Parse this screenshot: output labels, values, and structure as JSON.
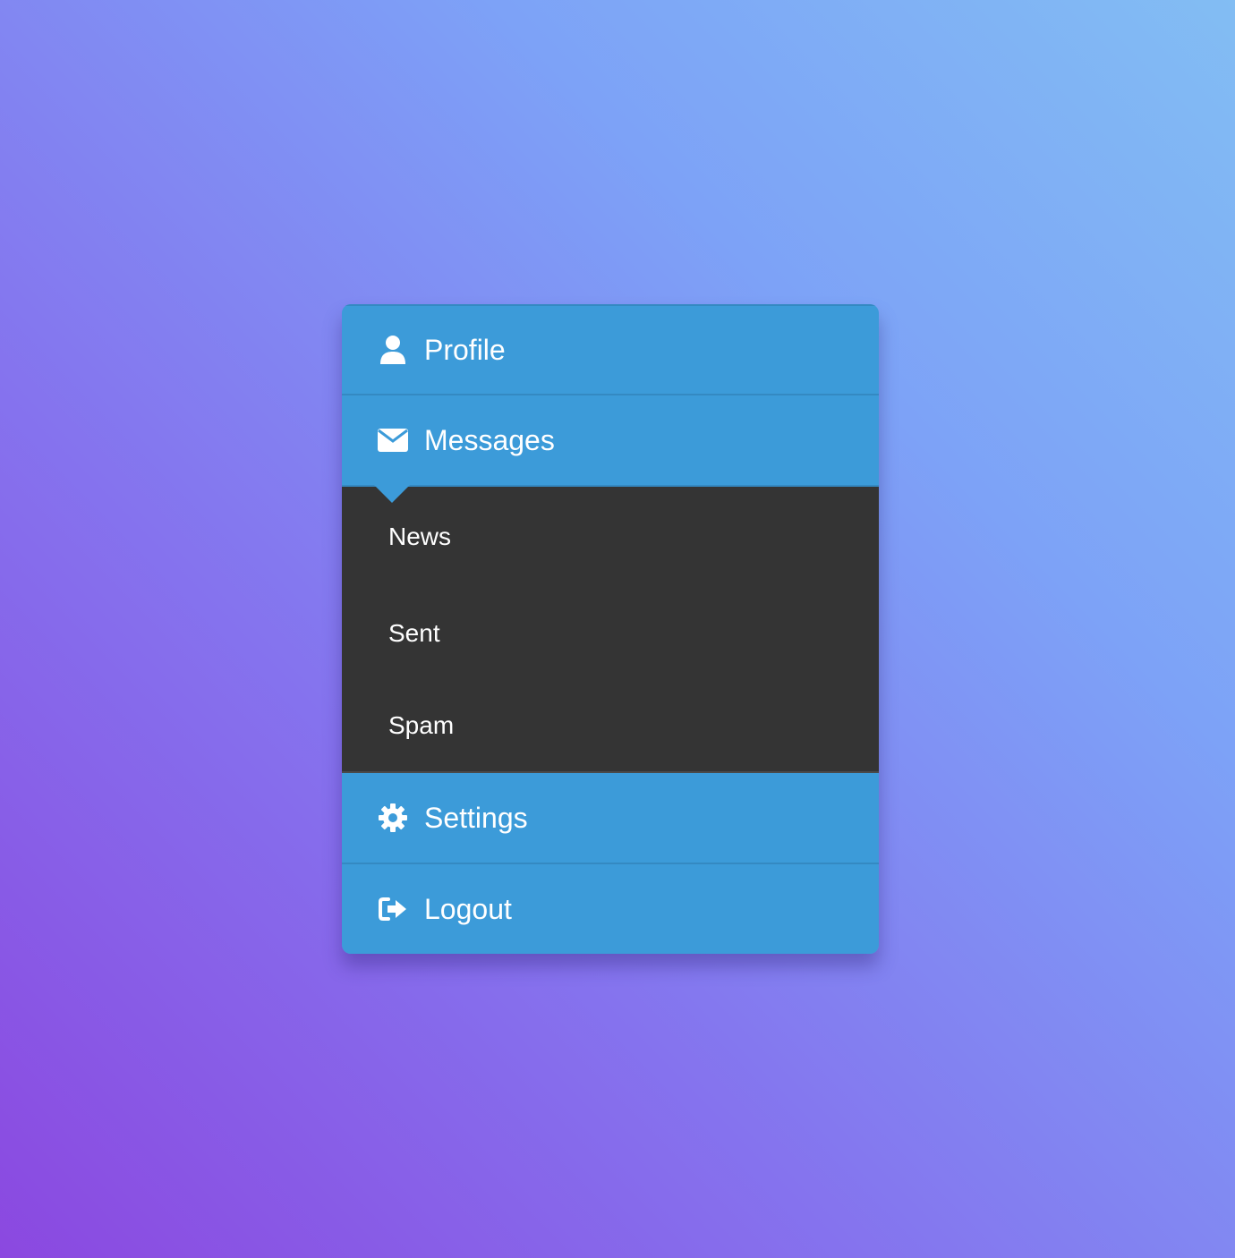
{
  "menu": {
    "items": [
      {
        "label": "Profile",
        "icon": "user-icon"
      },
      {
        "label": "Messages",
        "icon": "envelope-icon",
        "expanded": true,
        "subitems": [
          {
            "label": "News"
          },
          {
            "label": "Sent"
          },
          {
            "label": "Spam"
          }
        ]
      },
      {
        "label": "Settings",
        "icon": "gear-icon"
      },
      {
        "label": "Logout",
        "icon": "sign-out-icon"
      }
    ]
  },
  "colors": {
    "item_bg": "#3c9bd9",
    "item_border": "#3489c2",
    "submenu_bg": "#343434",
    "text": "#ffffff"
  }
}
